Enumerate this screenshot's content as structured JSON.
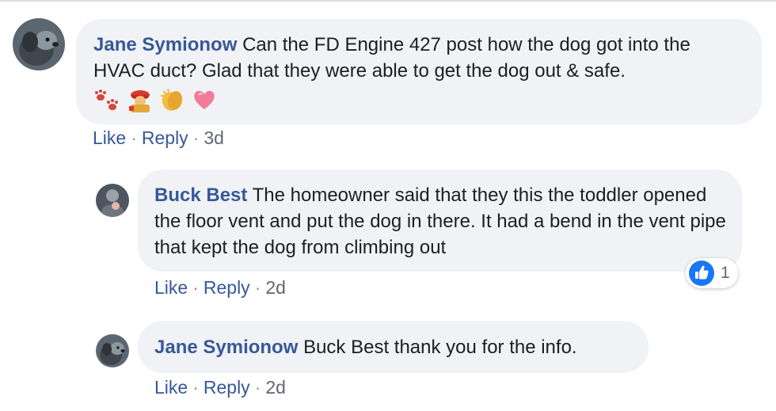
{
  "comments": [
    {
      "author": "Jane Symionow",
      "text": "Can the FD Engine 427 post how the dog got into the HVAC duct? Glad that they were able to get the dog out & safe.",
      "emojis": [
        "paw-prints",
        "firefighter",
        "clapping-hands",
        "heart"
      ],
      "like_label": "Like",
      "reply_label": "Reply",
      "time": "3d"
    },
    {
      "author": "Buck Best",
      "text": "The homeowner said that they this the toddler opened the floor vent and put the dog in there. It had a bend in the vent pipe that kept the dog from climbing out",
      "like_label": "Like",
      "reply_label": "Reply",
      "time": "2d",
      "reaction_count": "1"
    },
    {
      "author": "Jane Symionow",
      "text": "Buck Best thank you for the info.",
      "like_label": "Like",
      "reply_label": "Reply",
      "time": "2d"
    }
  ],
  "colors": {
    "link": "#385898",
    "bubble": "#f0f2f5",
    "like_blue": "#1877f2"
  }
}
